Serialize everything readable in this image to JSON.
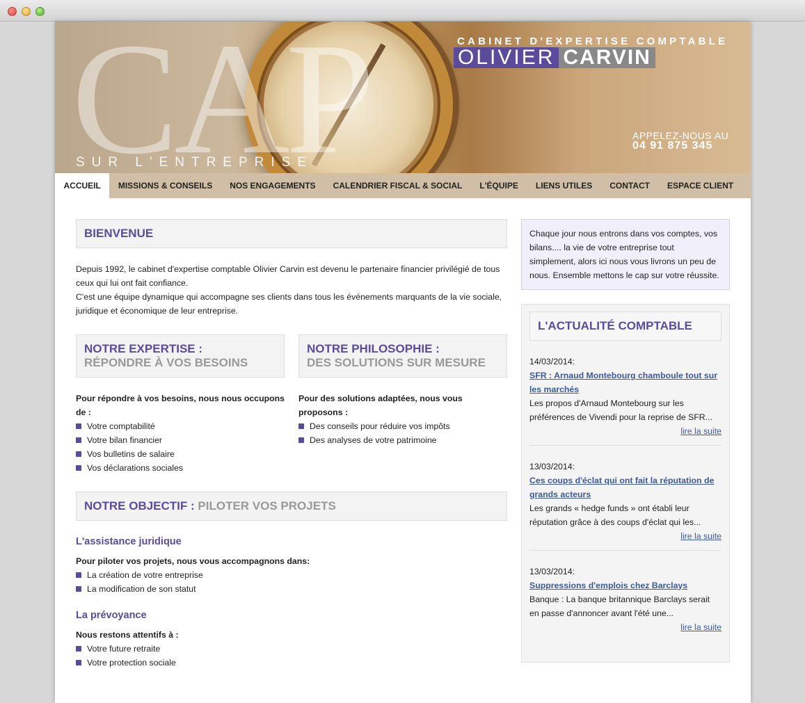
{
  "banner": {
    "cap_text": "CAP",
    "tagline": "SUR L'ENTREPRISE",
    "brand_top": "CABINET D'EXPERTISE COMPTABLE",
    "brand_first": "OLIVIER",
    "brand_last": "CARVIN",
    "phone_label": "APPELEZ-NOUS AU",
    "phone": "04 91 875 345"
  },
  "nav": {
    "items": [
      {
        "label": "ACCUEIL",
        "active": true
      },
      {
        "label": "MISSIONS & CONSEILS"
      },
      {
        "label": "NOS ENGAGEMENTS"
      },
      {
        "label": "CALENDRIER FISCAL & SOCIAL"
      },
      {
        "label": "L'ÉQUIPE"
      },
      {
        "label": "LIENS UTILES"
      },
      {
        "label": "CONTACT"
      },
      {
        "label": "ESPACE CLIENT"
      }
    ]
  },
  "welcome": {
    "title": "BIENVENUE",
    "p1": "Depuis 1992, le cabinet d'expertise comptable Olivier Carvin est devenu le partenaire financier privilégié de tous ceux qui lui ont fait confiance.",
    "p2": "C'est une équipe dynamique qui accompagne ses clients dans tous les événements marquants de la vie sociale, juridique et économique de leur entreprise."
  },
  "expertise": {
    "title": "NOTRE EXPERTISE :",
    "subtitle": "RÉPONDRE À VOS BESOINS",
    "lead": "Pour répondre à vos besoins, nous nous occupons de :",
    "items": [
      "Votre comptabilité",
      "Votre bilan financier",
      "Vos bulletins de salaire",
      "Vos déclarations sociales"
    ]
  },
  "philosophy": {
    "title": "NOTRE PHILOSOPHIE :",
    "subtitle": "DES SOLUTIONS SUR MESURE",
    "lead": "Pour des solutions adaptées, nous vous proposons :",
    "items": [
      "Des conseils pour réduire vos impôts",
      "Des analyses de votre patrimoine"
    ]
  },
  "objective": {
    "title": "NOTRE OBJECTIF :",
    "subtitle": "PILOTER VOS PROJETS",
    "section1": {
      "title": "L'assistance juridique",
      "lead": "Pour piloter vos projets, nous vous accompagnons dans:",
      "items": [
        "La création de votre entreprise",
        "La modification de son statut"
      ]
    },
    "section2": {
      "title": "La prévoyance",
      "lead": "Nous restons attentifs à :",
      "items": [
        "Votre future retraite",
        "Votre protection sociale"
      ]
    }
  },
  "sidebar": {
    "intro": "Chaque jour nous entrons dans vos comptes, vos bilans.... la vie de votre entreprise tout simplement, alors ici nous vous livrons un peu de nous. Ensemble mettons le cap sur votre réussite.",
    "news_title": "L'ACTUALITÉ COMPTABLE",
    "news": [
      {
        "date": "14/03/2014:",
        "title": "SFR : Arnaud Montebourg chamboule tout sur les marchés",
        "excerpt": "Les propos d'Arnaud Montebourg sur les préférences de Vivendi pour la reprise de SFR...",
        "more": "lire la suite"
      },
      {
        "date": "13/03/2014:",
        "title": "Ces coups d'éclat qui ont fait la réputation de grands acteurs",
        "excerpt": "Les grands « hedge funds » ont établi leur réputation grâce à des coups d'éclat qui les...",
        "more": "lire la suite"
      },
      {
        "date": "13/03/2014:",
        "title": "Suppressions d'emplois chez Barclays",
        "excerpt": "Banque : La banque britannique Barclays serait en passe d'annoncer avant l'été une...",
        "more": "lire la suite"
      }
    ]
  },
  "colors": {
    "accent": "#5b4b9a",
    "link": "#3c5a9a"
  }
}
